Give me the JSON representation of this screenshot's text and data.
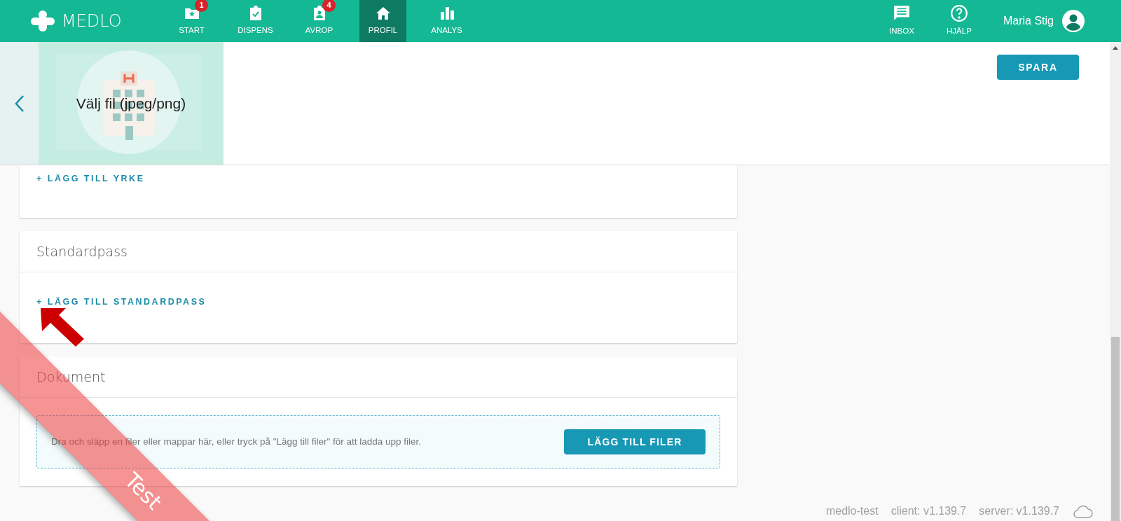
{
  "nav": {
    "logo": "MEDLO",
    "items": [
      {
        "label": "START",
        "badge": "1",
        "selected": false
      },
      {
        "label": "DISPENS",
        "selected": false
      },
      {
        "label": "AVROP",
        "badge": "4",
        "selected": false
      },
      {
        "label": "PROFIL",
        "selected": true
      },
      {
        "label": "ANALYS",
        "selected": false
      }
    ],
    "right_items": [
      {
        "label": "INBOX"
      },
      {
        "label": "HJÄLP"
      }
    ],
    "user": "Maria Stig"
  },
  "profile_header": {
    "image_prompt": "Välj fil (jpeg/png)",
    "save_button": "SPARA"
  },
  "sections": [
    {
      "kind": "action",
      "action": "+ LÄGG TILL YRKE"
    },
    {
      "kind": "titled",
      "title": "Standardpass",
      "action": "+ LÄGG TILL STANDARDPASS"
    },
    {
      "kind": "upload",
      "title": "Dokument",
      "dropzone_text": "Dra och släpp en filer eller mappar här, eller tryck på \"Lägg till filer\" för att ladda upp filer.",
      "button": "LÄGG TILL FILER"
    }
  ],
  "footer": [
    "medlo-test",
    "client: v1.139.7",
    "server: v1.139.7"
  ],
  "ribbon": "Test"
}
